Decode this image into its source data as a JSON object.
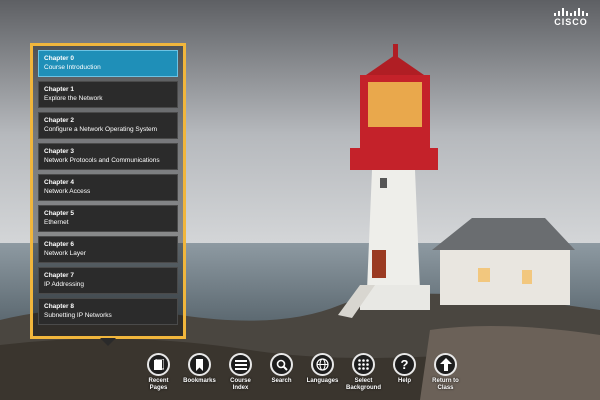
{
  "brand": {
    "logo_text": "CISCO"
  },
  "menu": {
    "chapters": [
      {
        "number": "Chapter 0",
        "title": "Course Introduction",
        "active": true
      },
      {
        "number": "Chapter 1",
        "title": "Explore the Network"
      },
      {
        "number": "Chapter 2",
        "title": "Configure a Network Operating System"
      },
      {
        "number": "Chapter 3",
        "title": "Network Protocols and Communications"
      },
      {
        "number": "Chapter 4",
        "title": "Network Access"
      },
      {
        "number": "Chapter 5",
        "title": "Ethernet"
      },
      {
        "number": "Chapter 6",
        "title": "Network Layer"
      },
      {
        "number": "Chapter 7",
        "title": "IP Addressing"
      },
      {
        "number": "Chapter 8",
        "title": "Subnetting IP Networks"
      }
    ]
  },
  "toolbar": {
    "items": [
      {
        "label": "Recent\nPages",
        "icon": "document-icon"
      },
      {
        "label": "Bookmarks",
        "icon": "bookmark-icon"
      },
      {
        "label": "Course\nIndex",
        "icon": "list-icon"
      },
      {
        "label": "Search",
        "icon": "search-icon"
      },
      {
        "label": "Languages",
        "icon": "globe-icon"
      },
      {
        "label": "Select\nBackground",
        "icon": "grid-icon"
      },
      {
        "label": "Help",
        "icon": "help-icon"
      },
      {
        "label": "Return to\nClass",
        "icon": "arrow-up-icon"
      }
    ]
  },
  "colors": {
    "menu_border": "#f1b63c",
    "active_chapter": "#1f8fb8"
  }
}
